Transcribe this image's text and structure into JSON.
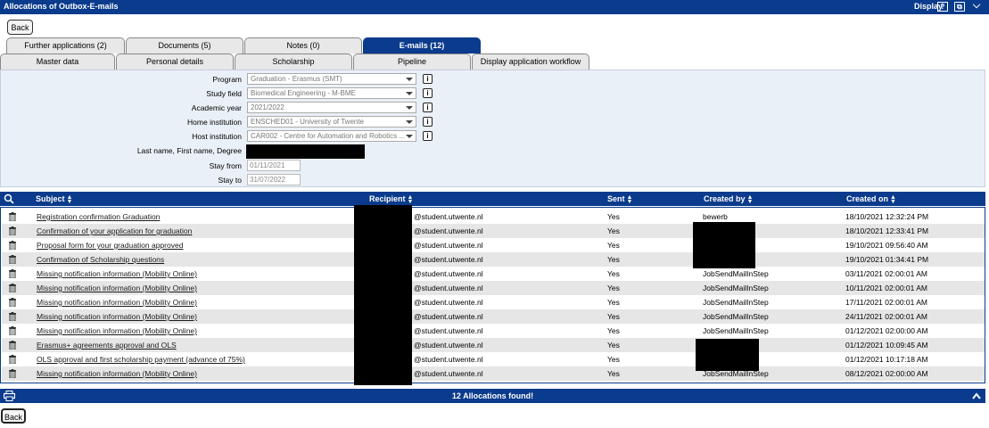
{
  "window": {
    "title": "Allocations of Outbox-E-mails",
    "display_label": "Display",
    "help_icon": "question-icon",
    "copy_icon": "copy-icon",
    "collapse_icon": "chevron-down-icon"
  },
  "back_label": "Back",
  "tabs_row1": [
    {
      "label": "Further applications (2)"
    },
    {
      "label": "Documents (5)"
    },
    {
      "label": "Notes (0)"
    },
    {
      "label": "E-mails (12)"
    }
  ],
  "tabs_row2": [
    {
      "label": "Master data"
    },
    {
      "label": "Personal details"
    },
    {
      "label": "Scholarship"
    },
    {
      "label": "Pipeline"
    },
    {
      "label": "Display application workflow"
    }
  ],
  "form": {
    "program": {
      "label": "Program",
      "value": "Graduation - Erasmus (SMT)"
    },
    "study_field": {
      "label": "Study field",
      "value": "Biomedical Engineering - M-BME"
    },
    "academic_year": {
      "label": "Academic year",
      "value": "2021/2022"
    },
    "home_institution": {
      "label": "Home institution",
      "value": "ENSCHED01 - University of Twente"
    },
    "host_institution": {
      "label": "Host institution",
      "value": "CAR002 - Centre for Automation and Robotics ..."
    },
    "name": {
      "label": "Last name, First name, Degree"
    },
    "stay_from": {
      "label": "Stay from",
      "value": "01/11/2021"
    },
    "stay_to": {
      "label": "Stay to",
      "value": "31/07/2022"
    }
  },
  "table": {
    "columns": {
      "subject": "Subject",
      "recipient": "Recipient",
      "sent": "Sent",
      "created_by": "Created by",
      "created_on": "Created on"
    },
    "rows": [
      {
        "subject": "Registration confirmation Graduation",
        "recipient": "@student.utwente.nl",
        "sent": "Yes",
        "created_by": "bewerb",
        "created_on": "18/10/2021 12:32:24 PM"
      },
      {
        "subject": "Confirmation of your application for graduation",
        "recipient": "@student.utwente.nl",
        "sent": "Yes",
        "created_by": "",
        "created_on": "18/10/2021 12:33:41 PM"
      },
      {
        "subject": "Proposal form for your graduation approved",
        "recipient": "@student.utwente.nl",
        "sent": "Yes",
        "created_by": "",
        "created_on": "19/10/2021 09:56:40 AM"
      },
      {
        "subject": "Confirmation of Scholarship questions",
        "recipient": "@student.utwente.nl",
        "sent": "Yes",
        "created_by": "",
        "created_on": "19/10/2021 01:34:41 PM"
      },
      {
        "subject": "Missing notification information (Mobility Online)",
        "recipient": "@student.utwente.nl",
        "sent": "Yes",
        "created_by": "JobSendMailInStep",
        "created_on": "03/11/2021 02:00:01 AM"
      },
      {
        "subject": "Missing notification information (Mobility Online)",
        "recipient": "@student.utwente.nl",
        "sent": "Yes",
        "created_by": "JobSendMailInStep",
        "created_on": "10/11/2021 02:00:01 AM"
      },
      {
        "subject": "Missing notification information (Mobility Online)",
        "recipient": "@student.utwente.nl",
        "sent": "Yes",
        "created_by": "JobSendMailInStep",
        "created_on": "17/11/2021 02:00:01 AM"
      },
      {
        "subject": "Missing notification information (Mobility Online)",
        "recipient": "@student.utwente.nl",
        "sent": "Yes",
        "created_by": "JobSendMailInStep",
        "created_on": "24/11/2021 02:00:01 AM"
      },
      {
        "subject": "Missing notification information (Mobility Online)",
        "recipient": "@student.utwente.nl",
        "sent": "Yes",
        "created_by": "JobSendMailInStep",
        "created_on": "01/12/2021 02:00:00 AM"
      },
      {
        "subject": "Erasmus+ agreements approval and OLS",
        "recipient": "@student.utwente.nl",
        "sent": "Yes",
        "created_by": "",
        "created_on": "01/12/2021 10:09:45 AM"
      },
      {
        "subject": "OLS approval and first scholarship payment (advance of 75%)",
        "recipient": "@student.utwente.nl",
        "sent": "Yes",
        "created_by": "",
        "created_on": "01/12/2021 10:17:18 AM"
      },
      {
        "subject": "Missing notification information (Mobility Online)",
        "recipient": "@student.utwente.nl",
        "sent": "Yes",
        "created_by": "JobSendMailInStep",
        "created_on": "08/12/2021 02:00:00 AM"
      }
    ]
  },
  "footer": {
    "status": "12 Allocations found!"
  }
}
